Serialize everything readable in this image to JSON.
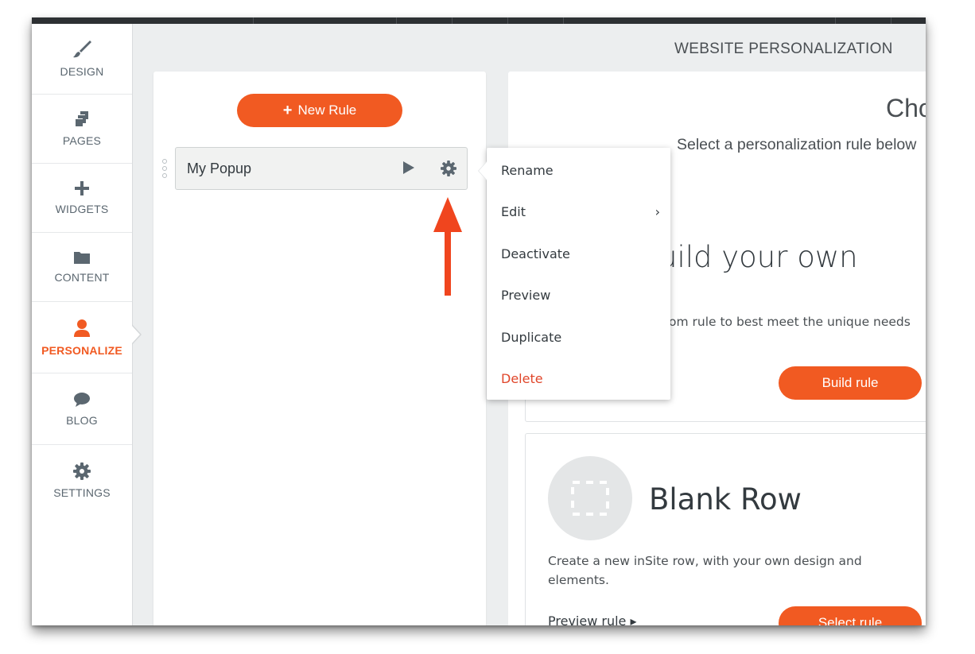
{
  "header": {
    "title": "WEBSITE PERSONALIZATION"
  },
  "sidebar": {
    "items": [
      {
        "label": "DESIGN",
        "icon": "brush-icon"
      },
      {
        "label": "PAGES",
        "icon": "pages-icon"
      },
      {
        "label": "WIDGETS",
        "icon": "plus-icon"
      },
      {
        "label": "CONTENT",
        "icon": "folder-icon"
      },
      {
        "label": "PERSONALIZE",
        "icon": "person-icon",
        "active": true
      },
      {
        "label": "BLOG",
        "icon": "chat-bubble-icon"
      },
      {
        "label": "SETTINGS",
        "icon": "gear-icon"
      }
    ]
  },
  "rules": {
    "new_rule_label": "New Rule",
    "items": [
      {
        "name": "My Popup"
      }
    ]
  },
  "context_menu": {
    "items": [
      {
        "label": "Rename"
      },
      {
        "label": "Edit",
        "submenu": true
      },
      {
        "label": "Deactivate"
      },
      {
        "label": "Preview"
      },
      {
        "label": "Duplicate"
      },
      {
        "label": "Delete",
        "danger": true
      }
    ]
  },
  "main": {
    "heading": "Cho",
    "subheading": "Select a personalization rule below",
    "build_card": {
      "title": "uild your own",
      "description": "om rule to best meet the unique needs",
      "button": "Build rule"
    },
    "blank_card": {
      "title": "Blank Row",
      "description": "Create a new inSite row, with your own design and elements.",
      "preview_link": "Preview rule ▸",
      "button": "Select rule"
    }
  },
  "colors": {
    "accent": "#f15a22",
    "danger": "#e0462a",
    "sidebar_text": "#5b6770"
  }
}
